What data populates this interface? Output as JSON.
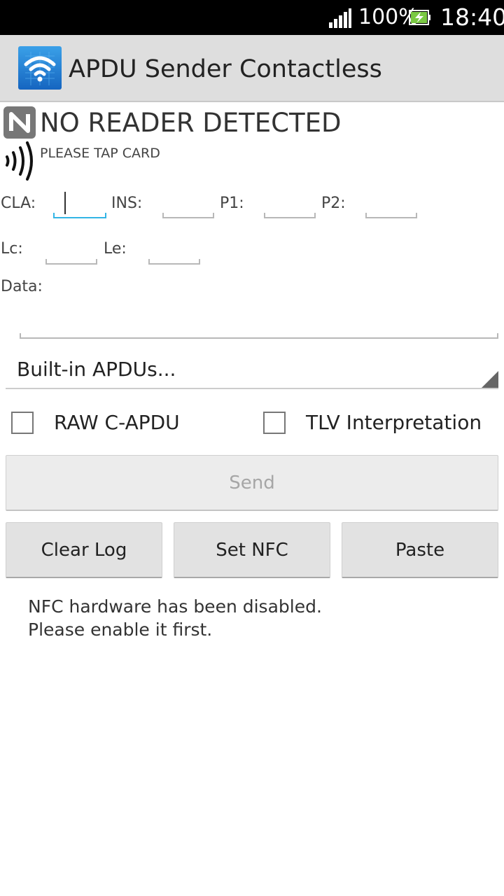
{
  "status_bar": {
    "battery_percent": "100%",
    "time": "18:40"
  },
  "action_bar": {
    "title": "APDU Sender Contactless",
    "icon": "wifi-card-icon"
  },
  "nfc": {
    "reader_status": "NO READER DETECTED",
    "tap_hint": "PLEASE TAP CARD"
  },
  "fields": {
    "cla_label": "CLA:",
    "ins_label": "INS:",
    "p1_label": "P1:",
    "p2_label": "P2:",
    "lc_label": "Lc:",
    "le_label": "Le:",
    "data_label": "Data:",
    "cla_value": "",
    "ins_value": "",
    "p1_value": "",
    "p2_value": "",
    "lc_value": "",
    "le_value": "",
    "data_value": ""
  },
  "spinner": {
    "selected": "Built-in APDUs..."
  },
  "options": {
    "raw_capdu_label": "RAW C-APDU",
    "raw_capdu_checked": false,
    "tlv_label": "TLV Interpretation",
    "tlv_checked": false
  },
  "buttons": {
    "send": "Send",
    "clear_log": "Clear Log",
    "set_nfc": "Set NFC",
    "paste": "Paste"
  },
  "log": {
    "line1": "NFC hardware has been disabled.",
    "line2": "Please enable it first."
  },
  "colors": {
    "accent": "#33b5e5",
    "action_bar_bg": "#dedede",
    "status_bar_bg": "#000000"
  }
}
